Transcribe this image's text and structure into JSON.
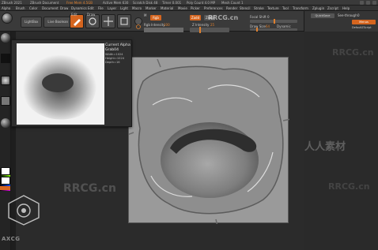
{
  "title_bar": {
    "segments": [
      "ZBrush 2021",
      "ZBrush Document",
      "Free Mem 4.5GB",
      "Active Mem 630",
      "Scratch Disk 48",
      "Timer 0.001",
      "Poly Count 4.0 MP",
      "Mesh Count 1"
    ],
    "accent": "#e0802e"
  },
  "menu": {
    "items": [
      "Alpha",
      "Brush",
      "Color",
      "Document",
      "Draw",
      "Dynamics",
      "Edit",
      "File",
      "Layer",
      "Light",
      "Macro",
      "Marker",
      "Material",
      "Movie",
      "Picker",
      "Preferences",
      "Render",
      "Stencil",
      "Stroke",
      "Texture",
      "Tool",
      "Transform",
      "Zplugin",
      "Zscript",
      "Help"
    ]
  },
  "toolbar": {
    "tray_tabs": [
      "LightBox",
      "Live Boolean"
    ],
    "edit_label": "Edit",
    "draw_label": "Draw",
    "rgb_label": "Rgb",
    "rgb_intensity_label": "Rgb Intensity",
    "rgb_intensity_value": "100",
    "z_label": "Zadd",
    "zsub_label": "Zsub",
    "z_intensity_label": "Z Intensity",
    "z_intensity_value": "25",
    "focal_shift_label": "Focal Shift",
    "focal_shift_value": "0",
    "draw_size_label": "Draw Size",
    "draw_size_value": "64",
    "dynamic_label": "Dynamic"
  },
  "right_shelf": {
    "quicksave": "QuickSave",
    "see_through": "See-through",
    "see_through_value": "0",
    "menus": "Menus",
    "default_zscript": "DefaultZScript"
  },
  "alpha_popup": {
    "title": "Current Alpha",
    "name": "Grab04",
    "width_label": "Width=1024",
    "height_label": "Height=1024",
    "depth_label": "Depth=16"
  },
  "watermark": "RRCG.cn",
  "watermark_cn": "人人素材",
  "brand": "AXCG",
  "colors": {
    "accent": "#d5651f",
    "ui_bg": "#2b2b2b",
    "canvas": "#9a9a9a"
  }
}
